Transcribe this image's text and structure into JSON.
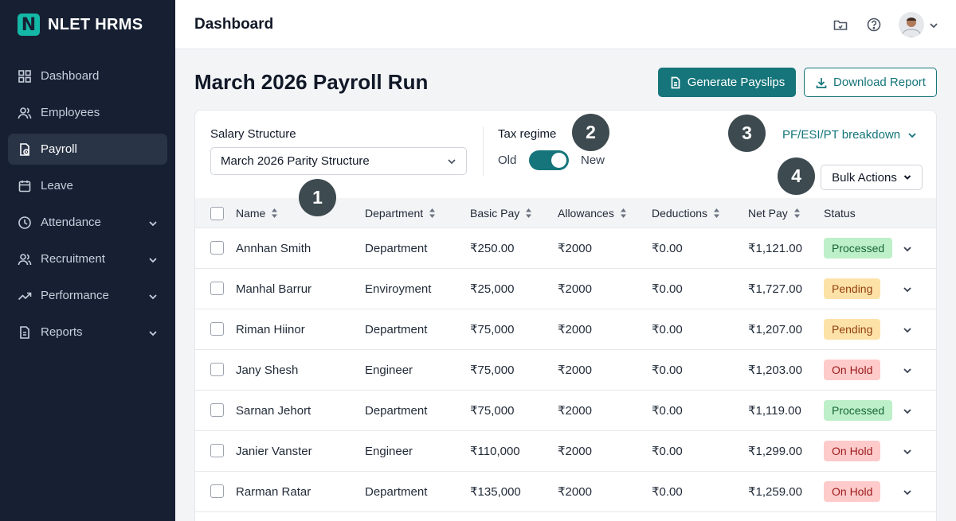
{
  "brand": {
    "logo_letter": "N",
    "name": "NLET HRMS"
  },
  "sidebar": {
    "items": [
      {
        "label": "Dashboard",
        "icon": "grid-icon",
        "active": false,
        "expandable": false
      },
      {
        "label": "Employees",
        "icon": "users-icon",
        "active": false,
        "expandable": false
      },
      {
        "label": "Payroll",
        "icon": "payroll-document-icon",
        "active": true,
        "expandable": false
      },
      {
        "label": "Leave",
        "icon": "calendar-icon",
        "active": false,
        "expandable": false
      },
      {
        "label": "Attendance",
        "icon": "clock-icon",
        "active": false,
        "expandable": true
      },
      {
        "label": "Recruitment",
        "icon": "users-icon",
        "active": false,
        "expandable": true
      },
      {
        "label": "Performance",
        "icon": "trending-up-icon",
        "active": false,
        "expandable": true
      },
      {
        "label": "Reports",
        "icon": "document-icon",
        "active": false,
        "expandable": true
      }
    ]
  },
  "header": {
    "title": "Dashboard"
  },
  "page": {
    "title": "March 2026 Payroll Run",
    "generate_label": "Generate Payslips",
    "download_label": "Download Report"
  },
  "filters": {
    "salary_label": "Salary Structure",
    "salary_value": "March 2026 Parity Structure",
    "tax_label": "Tax regime",
    "tax_old": "Old",
    "tax_new": "New",
    "breakdown_label": "PF/ESI/PT breakdown",
    "bulk_label": "Bulk Actions"
  },
  "badges": [
    "1",
    "2",
    "3",
    "4"
  ],
  "table": {
    "columns": [
      "Name",
      "Department",
      "Basic Pay",
      "Allowances",
      "Deductions",
      "Net Pay",
      "Status"
    ],
    "rows": [
      {
        "name": "Annhan Smith",
        "department": "Department",
        "basic": "₹250.00",
        "allowances": "₹2000",
        "deductions": "₹0.00",
        "net": "₹1,121.00",
        "status": "Processed"
      },
      {
        "name": "Manhal Barrur",
        "department": "Enviroyment",
        "basic": "₹25,000",
        "allowances": "₹2000",
        "deductions": "₹0.00",
        "net": "₹1,727.00",
        "status": "Pending"
      },
      {
        "name": "Riman Hiinor",
        "department": "Department",
        "basic": "₹75,000",
        "allowances": "₹2000",
        "deductions": "₹0.00",
        "net": "₹1,207.00",
        "status": "Pending"
      },
      {
        "name": "Jany Shesh",
        "department": "Engineer",
        "basic": "₹75,000",
        "allowances": "₹2000",
        "deductions": "₹0.00",
        "net": "₹1,203.00",
        "status": "On Hold"
      },
      {
        "name": "Sarnan Jehort",
        "department": "Department",
        "basic": "₹75,000",
        "allowances": "₹2000",
        "deductions": "₹0.00",
        "net": "₹1,119.00",
        "status": "Processed"
      },
      {
        "name": "Janier Vanster",
        "department": "Engineer",
        "basic": "₹110,000",
        "allowances": "₹2000",
        "deductions": "₹0.00",
        "net": "₹1,299.00",
        "status": "On Hold"
      },
      {
        "name": "Rarman Ratar",
        "department": "Department",
        "basic": "₹135,000",
        "allowances": "₹2000",
        "deductions": "₹0.00",
        "net": "₹1,259.00",
        "status": "On Hold"
      }
    ]
  },
  "colors": {
    "sidebar_bg": "#172033",
    "accent": "#15757a",
    "processed": "#bdf0c9",
    "pending": "#fde2a8",
    "on_hold": "#fecaca"
  }
}
